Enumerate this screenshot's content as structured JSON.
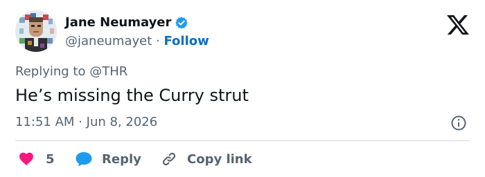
{
  "author": {
    "display_name": "Jane Neumayer",
    "handle": "@janeumayet",
    "separator": "·",
    "follow_label": "Follow",
    "verified_color": "#1d9bf0"
  },
  "reply_context": {
    "prefix": "Replying to",
    "mention": "@THR"
  },
  "tweet": {
    "text": "He’s missing the Curry strut",
    "time": "11:51 AM",
    "separator": "·",
    "date": "Jun 8, 2026"
  },
  "actions": {
    "like_count": "5",
    "reply_label": "Reply",
    "copy_label": "Copy link"
  },
  "colors": {
    "like": "#f91880",
    "reply": "#1d9bf0",
    "link": "#0a6fc2",
    "secondary_text": "#536471"
  },
  "icons": {
    "platform": "x-logo-icon",
    "verified": "verified-badge-icon",
    "info": "info-icon",
    "like": "heart-icon",
    "reply": "speech-bubble-icon",
    "copy": "link-icon"
  }
}
